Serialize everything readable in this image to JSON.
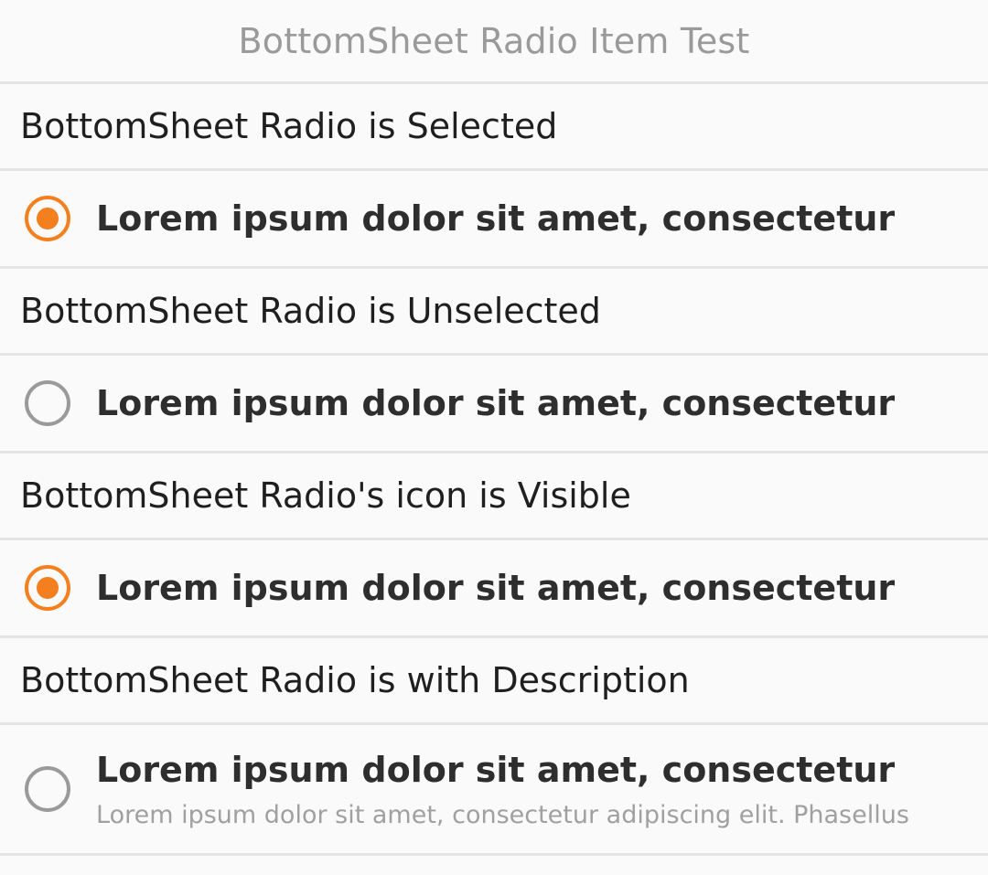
{
  "header": {
    "title": "BottomSheet Radio Item Test"
  },
  "colors": {
    "accent": "#f37f1e",
    "unselected": "#9a9a9a"
  },
  "sections": [
    {
      "label": "BottomSheet Radio is Selected",
      "item": {
        "title": "Lorem ipsum dolor sit amet, consectetur",
        "selected": true,
        "icon": "radio-selected-icon"
      }
    },
    {
      "label": "BottomSheet Radio is Unselected",
      "item": {
        "title": "Lorem ipsum dolor sit amet, consectetur",
        "selected": false,
        "icon": "radio-unselected-icon"
      }
    },
    {
      "label": "BottomSheet Radio's icon is Visible",
      "item": {
        "title": "Lorem ipsum dolor sit amet, consectetur",
        "selected": true,
        "icon": "radio-selected-icon"
      }
    },
    {
      "label": "BottomSheet Radio is with Description",
      "item": {
        "title": "Lorem ipsum dolor sit amet, consectetur",
        "description": "Lorem ipsum dolor sit amet, consectetur adipiscing elit. Phasellus",
        "selected": false,
        "icon": "radio-unselected-icon"
      }
    }
  ]
}
